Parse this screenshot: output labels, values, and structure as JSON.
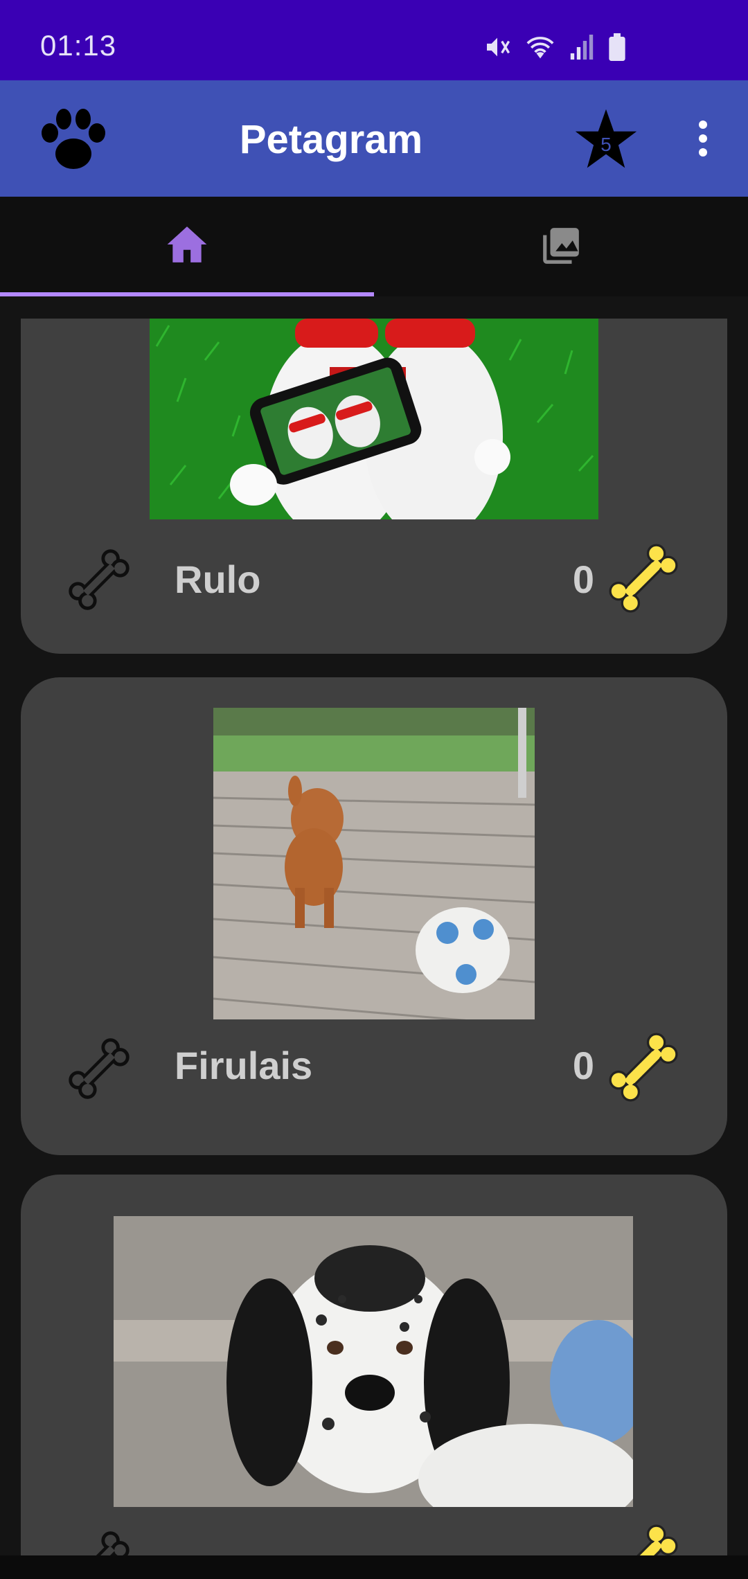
{
  "status_bar": {
    "time": "01:13",
    "icons": [
      "mute-icon",
      "wifi-icon",
      "signal-icon",
      "battery-icon"
    ]
  },
  "app_bar": {
    "title": "Petagram",
    "left_icon": "paw-icon",
    "favorites_badge": "5",
    "menu_icon": "overflow-menu-icon",
    "colors": {
      "status": "#3a00b4",
      "app_bar": "#3f51b5",
      "accent": "#b388ff"
    }
  },
  "tabs": [
    {
      "name": "home",
      "icon": "home-icon",
      "selected": true
    },
    {
      "name": "gallery",
      "icon": "photo-library-icon",
      "selected": false
    }
  ],
  "pets": [
    {
      "name": "Rulo",
      "likes": "0",
      "photo": "two dogs with red sunglasses taking a selfie on grass"
    },
    {
      "name": "Firulais",
      "likes": "0",
      "photo": "brown poodle on wooden deck with soccer ball"
    },
    {
      "name": "",
      "likes": "",
      "photo": "black and white spotted spaniel portrait"
    }
  ]
}
